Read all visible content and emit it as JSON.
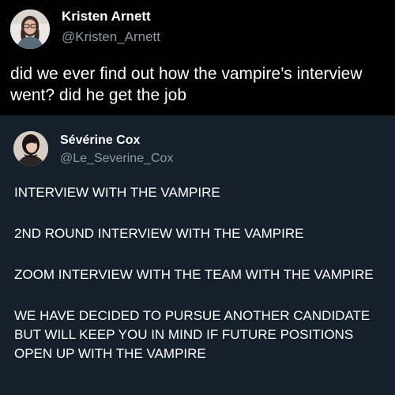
{
  "original_tweet": {
    "display_name": "Kristen Arnett",
    "handle": "@Kristen_Arnett",
    "text": "did we ever find out how the vampire’s interview went? did he get the job"
  },
  "reply_tweet": {
    "display_name": "Sévérine Cox",
    "handle": "@Le_Severine_Cox",
    "paragraphs": [
      "INTERVIEW WITH THE VAMPIRE",
      "2ND ROUND INTERVIEW WITH THE VAMPIRE",
      "ZOOM INTERVIEW WITH THE TEAM WITH THE VAMPIRE",
      "WE HAVE DECIDED TO PURSUE ANOTHER CANDIDATE BUT WILL KEEP YOU IN MIND IF FUTURE POSITIONS OPEN UP WITH THE VAMPIRE"
    ]
  },
  "colors": {
    "top_background": "#000000",
    "bottom_background": "#15202b",
    "text_primary": "#ffffff",
    "text_secondary": "#8b98a5"
  }
}
